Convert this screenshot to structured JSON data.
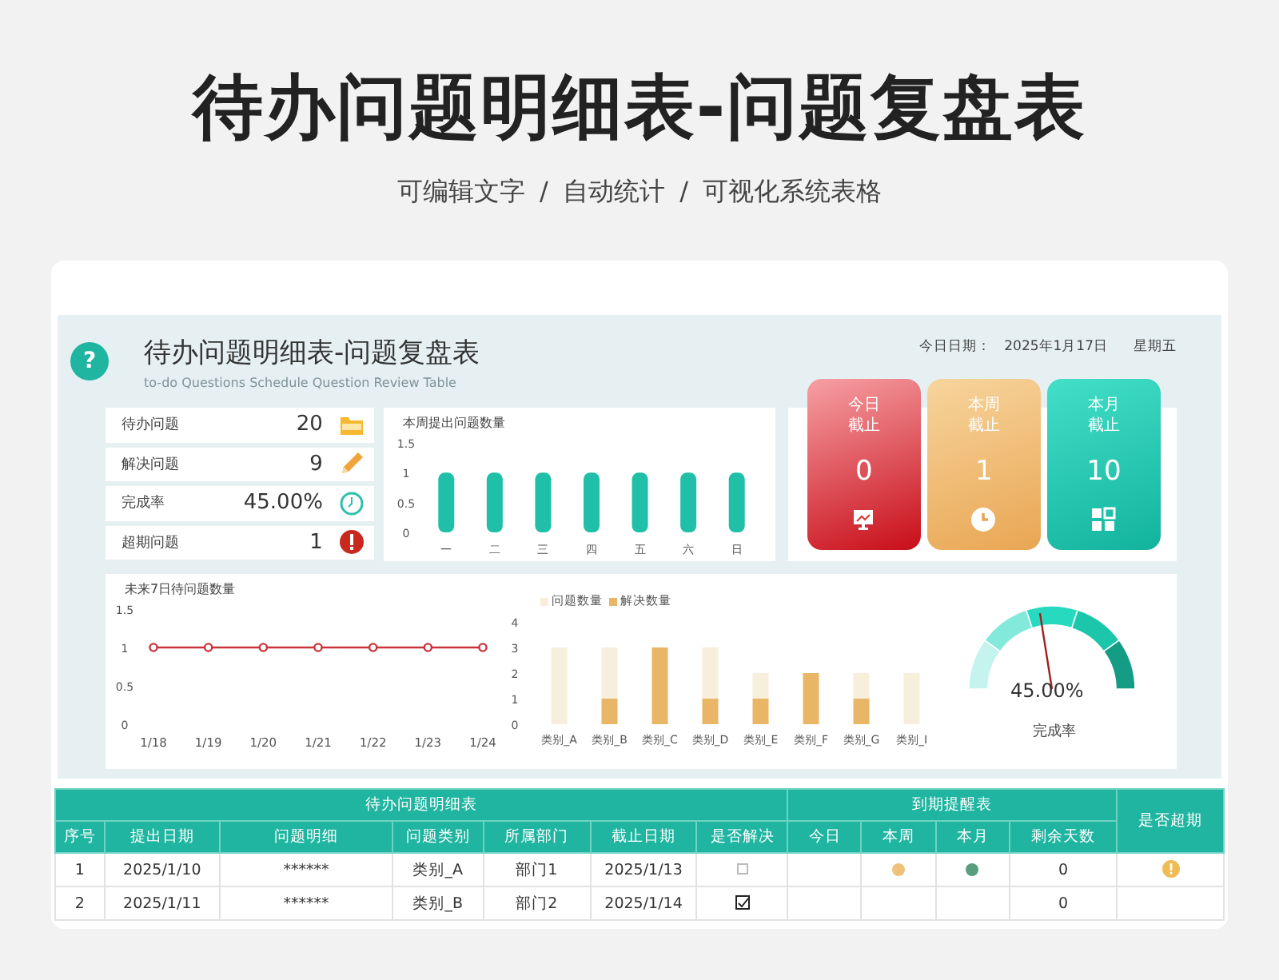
{
  "header": {
    "title": "待办问题明细表-问题复盘表",
    "subtitle": "可编辑文字 / 自动统计 / 可视化系统表格"
  },
  "dashboard": {
    "badge": "?",
    "title": "待办问题明细表-问题复盘表",
    "subtitle": "to-do Questions Schedule Question Review Table",
    "date_label": "今日日期：",
    "date_value": "2025年1月17日",
    "weekday": "星期五"
  },
  "kpis": [
    {
      "label": "待办问题",
      "value": "20",
      "kind": "folder"
    },
    {
      "label": "解决问题",
      "value": "9",
      "kind": "pencil"
    },
    {
      "label": "完成率",
      "value": "45.00%",
      "kind": "clock"
    },
    {
      "label": "超期问题",
      "value": "1",
      "kind": "alert"
    }
  ],
  "weekly_chart": {
    "chart_data": {
      "type": "bar",
      "title": "本周提出问题数量",
      "categories": [
        "一",
        "二",
        "三",
        "四",
        "五",
        "六",
        "日"
      ],
      "values": [
        1,
        1,
        1,
        1,
        1,
        1,
        1
      ],
      "ylim": [
        0,
        1.5
      ],
      "yticks": [
        0,
        0.5,
        1,
        1.5
      ]
    }
  },
  "deadline_cards": [
    {
      "line1": "今日",
      "line2": "截止",
      "value": "0",
      "kind": "today"
    },
    {
      "line1": "本周",
      "line2": "截止",
      "value": "1",
      "kind": "week"
    },
    {
      "line1": "本月",
      "line2": "截止",
      "value": "10",
      "kind": "month"
    }
  ],
  "future_chart": {
    "chart_data": {
      "type": "line",
      "title": "未来7日待问题数量",
      "categories": [
        "1/18",
        "1/19",
        "1/20",
        "1/21",
        "1/22",
        "1/23",
        "1/24"
      ],
      "values": [
        1,
        1,
        1,
        1,
        1,
        1,
        1
      ],
      "marker": "circle",
      "ylim": [
        0,
        1.5
      ],
      "yticks": [
        0,
        0.5,
        1,
        1.5
      ]
    }
  },
  "category_chart": {
    "chart_data": {
      "type": "bar",
      "categories": [
        "类别_A",
        "类别_B",
        "类别_C",
        "类别_D",
        "类别_E",
        "类别_F",
        "类别_G",
        "类别_I"
      ],
      "stacked": true,
      "legend": true,
      "series": [
        {
          "name": "问题数量",
          "color": "#f8eedc",
          "values": [
            3,
            2,
            0,
            2,
            1,
            0,
            1,
            2
          ]
        },
        {
          "name": "解决数量",
          "color": "#e9b566",
          "values": [
            0,
            1,
            3,
            1,
            1,
            2,
            1,
            0
          ]
        }
      ],
      "ylim": [
        0,
        4
      ],
      "yticks": [
        0,
        1,
        2,
        3,
        4
      ]
    }
  },
  "gauge": {
    "value": "45.00%",
    "label": "完成率",
    "level": 0.45
  },
  "table": {
    "groups": [
      {
        "label": "待办问题明细表"
      },
      {
        "label": "到期提醒表"
      }
    ],
    "overdue_header": "是否超期",
    "columns": [
      "序号",
      "提出日期",
      "问题明细",
      "问题类别",
      "所属部门",
      "截止日期",
      "是否解决",
      "今日",
      "本周",
      "本月",
      "剩余天数"
    ],
    "rows": [
      {
        "no": "1",
        "date": "2025/1/10",
        "detail": "******",
        "category": "类别_A",
        "dept": "部门1",
        "deadline": "2025/1/13",
        "resolved": false,
        "today": false,
        "week": true,
        "month": true,
        "remaining": "0",
        "overdue": true
      },
      {
        "no": "2",
        "date": "2025/1/11",
        "detail": "******",
        "category": "类别_B",
        "dept": "部门2",
        "deadline": "2025/1/14",
        "resolved": true,
        "today": false,
        "week": false,
        "month": false,
        "remaining": "0",
        "overdue": false
      }
    ]
  }
}
